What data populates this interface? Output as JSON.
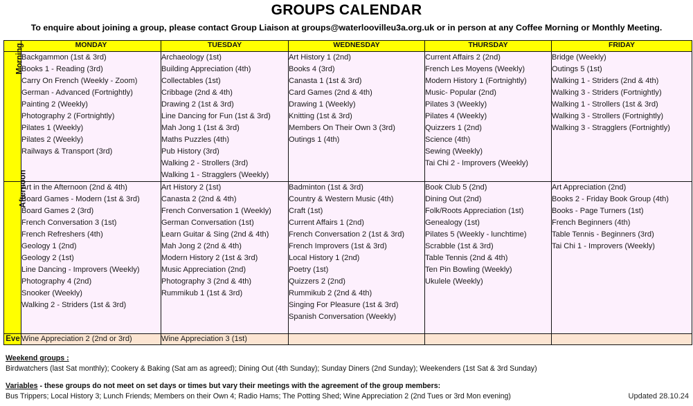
{
  "header": {
    "title": "GROUPS CALENDAR",
    "subtitle": "To enquire about joining a group, please contact Group Liaison at groups@waterloovilleu3a.org.uk or in person at any Coffee Morning or Monthly Meeting."
  },
  "colors": {
    "header_yellow": "#ffff00",
    "cell_pink": "#fdf0fd",
    "eve_peach": "#fce5d2"
  },
  "days": [
    "MONDAY",
    "TUESDAY",
    "WEDNESDAY",
    "THURSDAY",
    "FRIDAY"
  ],
  "row_labels": {
    "morning": "Morning",
    "afternoon": "Afternoon",
    "eve": "Eve"
  },
  "schedule": {
    "morning": [
      [
        "Backgammon (1st & 3rd)",
        "Books 1 - Reading (3rd)",
        "Carry On French (Weekly - Zoom)",
        "German - Advanced (Fortnightly)",
        "Painting 2  (Weekly)",
        "Photography 2 (Fortnightly)",
        "Pilates 1 (Weekly)",
        "Pilates 2  (Weekly)",
        "Railways & Transport (3rd)"
      ],
      [
        "Archaeology (1st)",
        "Building Appreciation (4th)",
        "Collectables (1st)",
        "Cribbage (2nd & 4th)",
        "Drawing 2 (1st & 3rd)",
        "Line Dancing for Fun (1st & 3rd)",
        "Mah Jong 1 (1st & 3rd)",
        "Maths Puzzles (4th)",
        "Pub History (3rd)",
        "Walking 2 - Strollers (3rd)",
        "Walking 1 - Stragglers (Weekly)"
      ],
      [
        "Art History 1 (2nd)",
        "Books 4 (3rd)",
        "Canasta 1 (1st & 3rd)",
        "Card Games (2nd & 4th)",
        "Drawing 1 (Weekly)",
        "Knitting  (1st & 3rd)",
        "Members On Their Own 3 (3rd)",
        "Outings 1 (4th)"
      ],
      [
        "Current Affairs 2 (2nd)",
        "French Les Moyens (Weekly)",
        "Modern History 1 (Fortnightly)",
        "Music- Popular (2nd)",
        "Pilates 3 (Weekly)",
        "Pilates 4 (Weekly)",
        "Quizzers 1 (2nd)",
        "Science (4th)",
        "Sewing (Weekly)",
        "Tai Chi 2 - Improvers (Weekly)"
      ],
      [
        "Bridge (Weekly)",
        "Outings 5 (1st)",
        "Walking 1 - Striders (2nd & 4th)",
        "Walking 3 - Striders (Fortnightly)",
        "Walking 1 - Strollers  (1st & 3rd)",
        "Walking 3 - Strollers (Fortnightly)",
        "Walking 3 - Stragglers (Fortnightly)"
      ]
    ],
    "afternoon": [
      [
        "Art in the Afternoon (2nd & 4th)",
        "Board Games - Modern (1st & 3rd)",
        "Board Games 2 (3rd)",
        "French Conversation 3 (1st)",
        "French Refreshers (4th)",
        "Geology 1 (2nd)",
        "Geology 2 (1st)",
        "Line Dancing - Improvers (Weekly)",
        "Photography 4 (2nd)",
        "Snooker  (Weekly)",
        "Walking 2 - Striders (1st & 3rd)"
      ],
      [
        "Art History 2 (1st)",
        "Canasta 2 (2nd & 4th)",
        "French Conversation 1 (Weekly)",
        "German Conversation (1st)",
        "Learn Guitar & Sing (2nd & 4th)",
        "Mah Jong 2 (2nd & 4th)",
        "Modern History 2 (1st & 3rd)",
        "Music Appreciation (2nd)",
        "Photography 3 (2nd & 4th)",
        "Rummikub 1 (1st & 3rd)"
      ],
      [
        "Badminton (1st & 3rd)",
        "Country & Western Music (4th)",
        "Craft (1st)",
        "Current Affairs 1 (2nd)",
        "French Conversation 2  (1st & 3rd)",
        "French Improvers (1st & 3rd)",
        "Local History 1 (2nd)",
        "Poetry (1st)",
        "Quizzers 2 (2nd)",
        "Rummikub 2  (2nd & 4th)",
        "Singing For Pleasure (1st & 3rd)",
        "Spanish Conversation (Weekly)"
      ],
      [
        "Book Club 5 (2nd)",
        "Dining Out (2nd)",
        "Folk/Roots Appreciation (1st)",
        "Genealogy (1st)",
        "Pilates 5 (Weekly - lunchtime)",
        "Scrabble (1st & 3rd)",
        "Table Tennis (2nd & 4th)",
        "Ten Pin Bowling (Weekly)",
        "Ukulele (Weekly)"
      ],
      [
        "Art Appreciation (2nd)",
        "Books 2 - Friday Book Group (4th)",
        "Books - Page Turners (1st)",
        "French Beginners (4th)",
        "Table Tennis - Beginners (3rd)",
        "Tai Chi 1 - Improvers (Weekly)"
      ]
    ],
    "eve": [
      [
        "Wine Appreciation 2 (2nd or 3rd)"
      ],
      [
        "Wine Appreciation 3 (1st)"
      ],
      [],
      [],
      []
    ]
  },
  "footer": {
    "weekend_heading": "Weekend groups :",
    "weekend_text": "Birdwatchers (last Sat monthly); Cookery & Baking (Sat am as agreed); Dining Out (4th Sunday); Sunday Diners (2nd Sunday); Weekenders (1st Sat & 3rd Sunday)",
    "variables_heading": "Variables",
    "variables_intro": " - these groups do not meet on set days or times but vary their meetings with the agreement of the group members:",
    "variables_text": "Bus Trippers;  Local History 3; Lunch Friends; Members on their Own 4; Radio Hams; The Potting Shed; Wine Appreciation 2 (2nd Tues or 3rd Mon evening)",
    "updated": "Updated 28.10.24"
  }
}
